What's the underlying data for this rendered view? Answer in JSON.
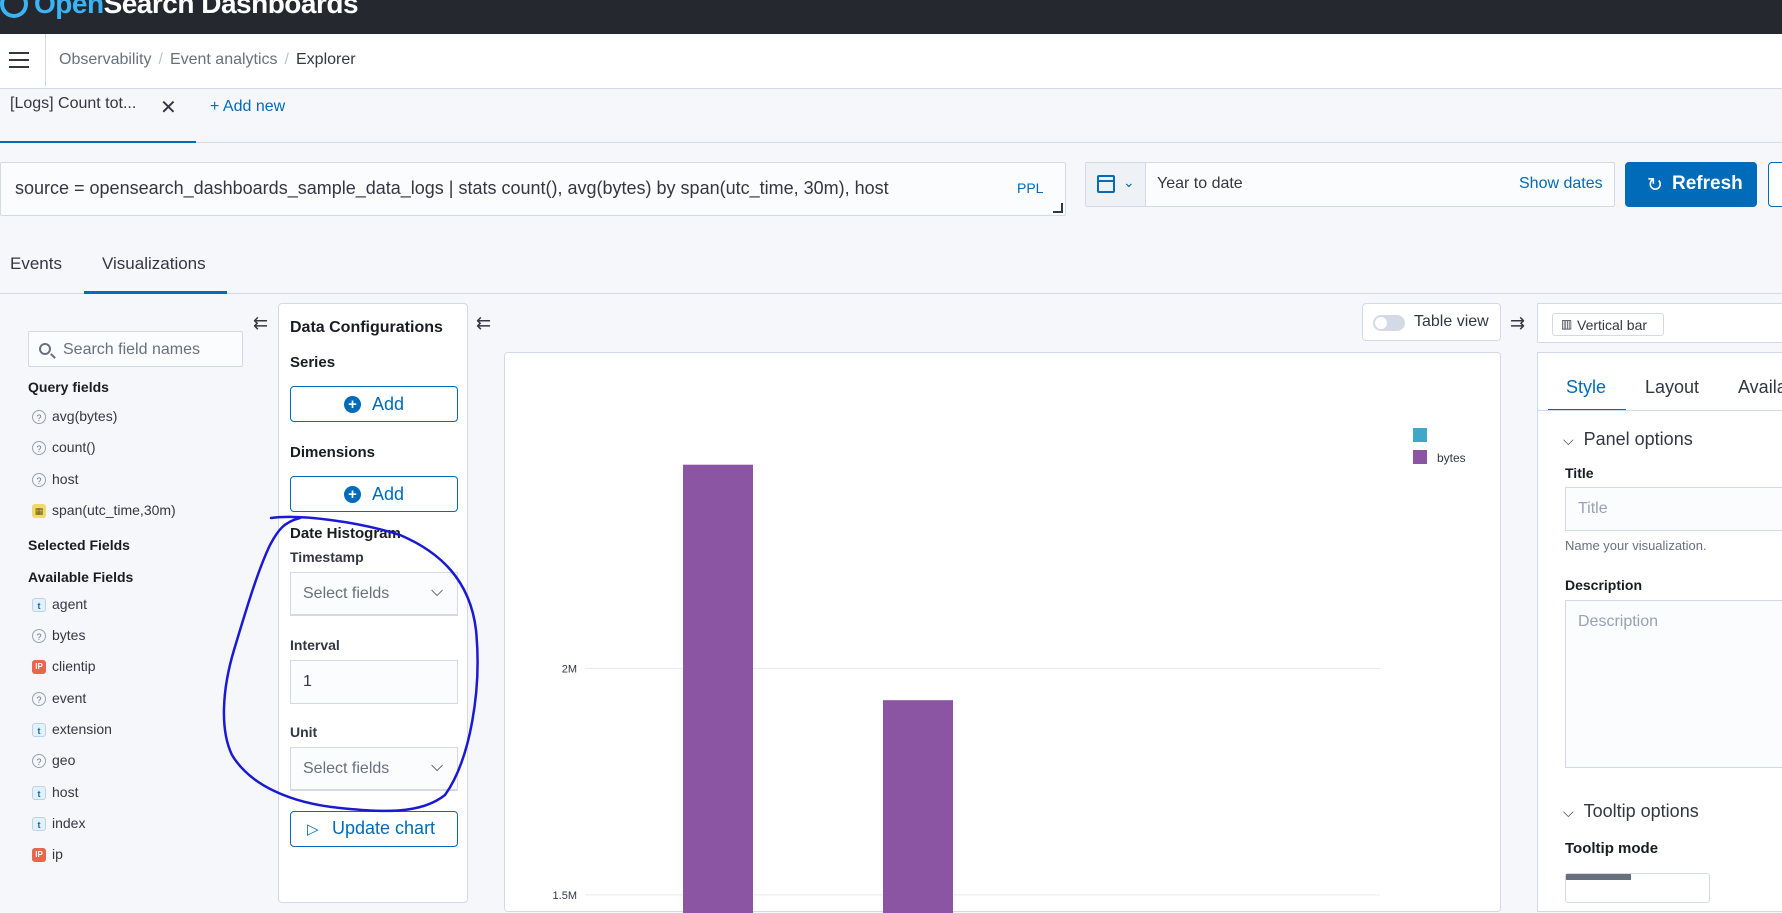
{
  "app": {
    "brand_prefix": "Open",
    "brand_rest": "Search Dashboards"
  },
  "breadcrumb": {
    "items": [
      "Observability",
      "Event analytics"
    ],
    "current": "Explorer"
  },
  "query_tabs": {
    "active_label": "[Logs] Count tot...",
    "add_new_label": "+ Add new"
  },
  "search": {
    "query": "source = opensearch_dashboards_sample_data_logs | stats count(), avg(bytes) by span(utc_time, 30m), host",
    "language_badge": "PPL"
  },
  "date_picker": {
    "range_label": "Year to date",
    "show_dates_label": "Show dates"
  },
  "refresh": {
    "label": "Refresh"
  },
  "view_tabs": {
    "events": "Events",
    "visualizations": "Visualizations"
  },
  "sidebar": {
    "search_placeholder": "Search field names",
    "query_fields_title": "Query fields",
    "query_fields": [
      {
        "name": "avg(bytes)",
        "type": "number"
      },
      {
        "name": "count()",
        "type": "number"
      },
      {
        "name": "host",
        "type": "number"
      },
      {
        "name": "span(utc_time,30m)",
        "type": "date"
      }
    ],
    "selected_fields_title": "Selected Fields",
    "available_fields_title": "Available Fields",
    "available_fields": [
      {
        "name": "agent",
        "type": "string"
      },
      {
        "name": "bytes",
        "type": "number"
      },
      {
        "name": "clientip",
        "type": "ip"
      },
      {
        "name": "event",
        "type": "number"
      },
      {
        "name": "extension",
        "type": "string"
      },
      {
        "name": "geo",
        "type": "number"
      },
      {
        "name": "host",
        "type": "string"
      },
      {
        "name": "index",
        "type": "string"
      },
      {
        "name": "ip",
        "type": "ip"
      }
    ]
  },
  "config": {
    "title": "Data Configurations",
    "series_title": "Series",
    "dimensions_title": "Dimensions",
    "add_label": "Add",
    "date_histogram_title": "Date Histogram",
    "timestamp_label": "Timestamp",
    "select_placeholder": "Select fields",
    "interval_label": "Interval",
    "interval_value": "1",
    "unit_label": "Unit",
    "update_label": "Update chart"
  },
  "table_view_label": "Table view",
  "vis_type_label": "Vertical bar",
  "right_panel": {
    "tabs": [
      "Style",
      "Layout",
      "Availa"
    ],
    "panel_options": "Panel options",
    "title_label": "Title",
    "title_placeholder": "Title",
    "title_help": "Name your visualization.",
    "description_label": "Description",
    "description_placeholder": "Description",
    "tooltip_options": "Tooltip options",
    "tooltip_mode_label": "Tooltip mode"
  },
  "colors": {
    "accent": "#006bb8",
    "bar": "#8c55a3",
    "legend_series_1": "#3ea8c8",
    "annotation": "#1a1ad6"
  },
  "chart_data": {
    "type": "bar",
    "series": [
      {
        "name": "",
        "color": "#3ea8c8",
        "values": []
      },
      {
        "name": "bytes",
        "color": "#8c55a3",
        "values": [
          2.45,
          1.93
        ]
      }
    ],
    "categories": [
      "",
      ""
    ],
    "y_ticks": [
      "2M",
      "1.5M"
    ],
    "y_tick_values": [
      2.0,
      1.5
    ],
    "y_unit": "M",
    "ylim_visible": [
      1.46,
      2.52
    ],
    "legend_position": "top-right",
    "grid": true
  }
}
